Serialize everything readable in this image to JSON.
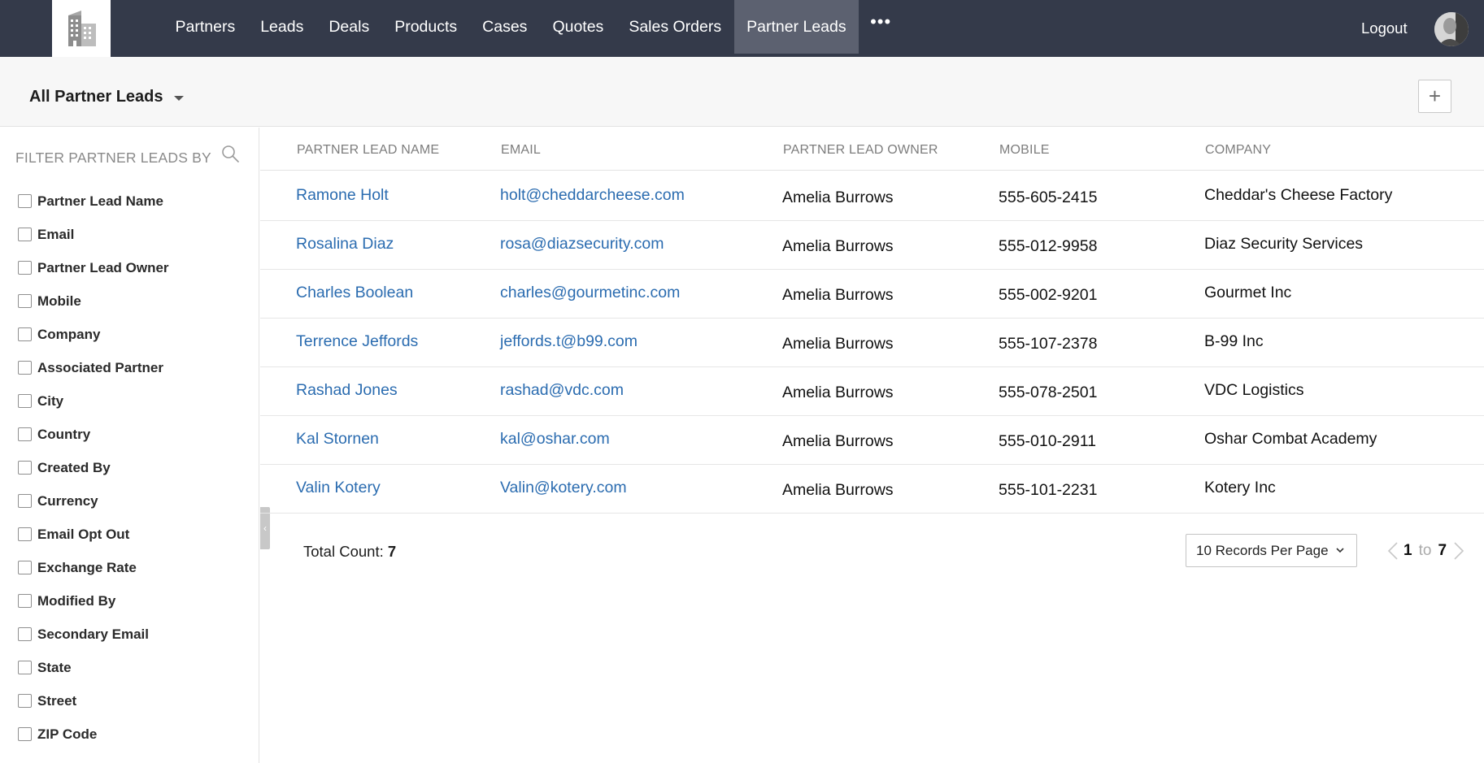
{
  "nav": {
    "items": [
      {
        "label": "Partners",
        "active": false
      },
      {
        "label": "Leads",
        "active": false
      },
      {
        "label": "Deals",
        "active": false
      },
      {
        "label": "Products",
        "active": false
      },
      {
        "label": "Cases",
        "active": false
      },
      {
        "label": "Quotes",
        "active": false
      },
      {
        "label": "Sales Orders",
        "active": false
      },
      {
        "label": "Partner Leads",
        "active": true
      }
    ],
    "more_label": "•••",
    "logout_label": "Logout"
  },
  "subheader": {
    "view_label": "All Partner Leads",
    "add_label": "+"
  },
  "sidebar": {
    "title": "FILTER PARTNER LEADS BY",
    "filters": [
      "Partner Lead Name",
      "Email",
      "Partner Lead Owner",
      "Mobile",
      "Company",
      "Associated Partner",
      "City",
      "Country",
      "Created By",
      "Currency",
      "Email Opt Out",
      "Exchange Rate",
      "Modified By",
      "Secondary Email",
      "State",
      "Street",
      "ZIP Code"
    ]
  },
  "table": {
    "columns": [
      "PARTNER LEAD NAME",
      "EMAIL",
      "PARTNER LEAD OWNER",
      "MOBILE",
      "COMPANY"
    ],
    "rows": [
      {
        "name": "Ramone Holt",
        "email": "holt@cheddarcheese.com",
        "owner": "Amelia Burrows",
        "mobile": "555-605-2415",
        "company": "Cheddar's Cheese Factory"
      },
      {
        "name": "Rosalina Diaz",
        "email": "rosa@diazsecurity.com",
        "owner": "Amelia Burrows",
        "mobile": "555-012-9958",
        "company": "Diaz Security Services"
      },
      {
        "name": "Charles Boolean",
        "email": "charles@gourmetinc.com",
        "owner": "Amelia Burrows",
        "mobile": "555-002-9201",
        "company": "Gourmet Inc"
      },
      {
        "name": "Terrence Jeffords",
        "email": "jeffords.t@b99.com",
        "owner": "Amelia Burrows",
        "mobile": "555-107-2378",
        "company": "B-99 Inc"
      },
      {
        "name": "Rashad Jones",
        "email": "rashad@vdc.com",
        "owner": "Amelia Burrows",
        "mobile": "555-078-2501",
        "company": "VDC Logistics"
      },
      {
        "name": "Kal Stornen",
        "email": "kal@oshar.com",
        "owner": "Amelia Burrows",
        "mobile": "555-010-2911",
        "company": "Oshar Combat Academy"
      },
      {
        "name": "Valin Kotery",
        "email": "Valin@kotery.com",
        "owner": "Amelia Burrows",
        "mobile": "555-101-2231",
        "company": "Kotery Inc"
      }
    ]
  },
  "footer": {
    "total_label": "Total Count:",
    "total_value": "7",
    "per_page": "10 Records Per Page",
    "page_from": "1",
    "page_to_word": "to",
    "page_to": "7"
  },
  "colors": {
    "topbar": "#343a4a",
    "active_tab": "#5c6170",
    "link": "#2b6cb0"
  }
}
